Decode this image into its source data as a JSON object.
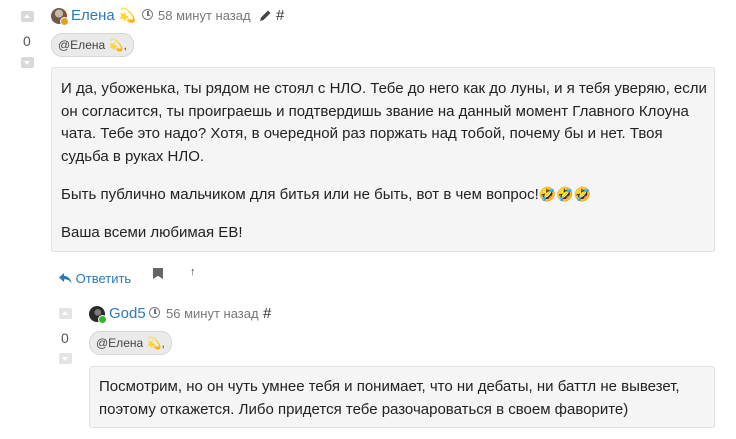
{
  "comment1": {
    "author": "Елена",
    "author_emoji": "💫",
    "time": "58 минут назад",
    "hash": "#",
    "votes": "0",
    "mention": "@Елена 💫,",
    "paragraphs": [
      "И да, убоженька, ты рядом не стоял с НЛО. Тебе до него как до луны, и я тебя уверяю, если",
      "он согласится, ты проиграешь и подтвердишь звание на данный момент Главного Клоуна",
      "чата. Тебе это надо? Хотя, в очередной раз поржать над тобой, почему бы и нет. Твоя",
      "судьба в руках НЛО."
    ],
    "paragraph2": "Быть публично мальчиком для битья или не быть, вот в чем вопрос!",
    "paragraph2_emoji": "🤣🤣🤣",
    "paragraph3": "Ваша всеми любимая ЕВ!",
    "reply_label": "Ответить",
    "share_arrow": "↑"
  },
  "comment2": {
    "author": "God5",
    "time": "56 минут назад",
    "hash": "#",
    "votes": "0",
    "mention": "@Елена 💫,",
    "lines": [
      "Посмотрим, но он чуть умнее тебя и понимает, что ни дебаты, ни баттл не вывезет,",
      "поэтому откажется. Либо придется тебе разочароваться в своем фаворите)"
    ]
  },
  "icons": {
    "edit": "pencil-icon",
    "clock": "clock-icon",
    "reply": "reply-arrow-icon",
    "bookmark": "bookmark-icon"
  }
}
